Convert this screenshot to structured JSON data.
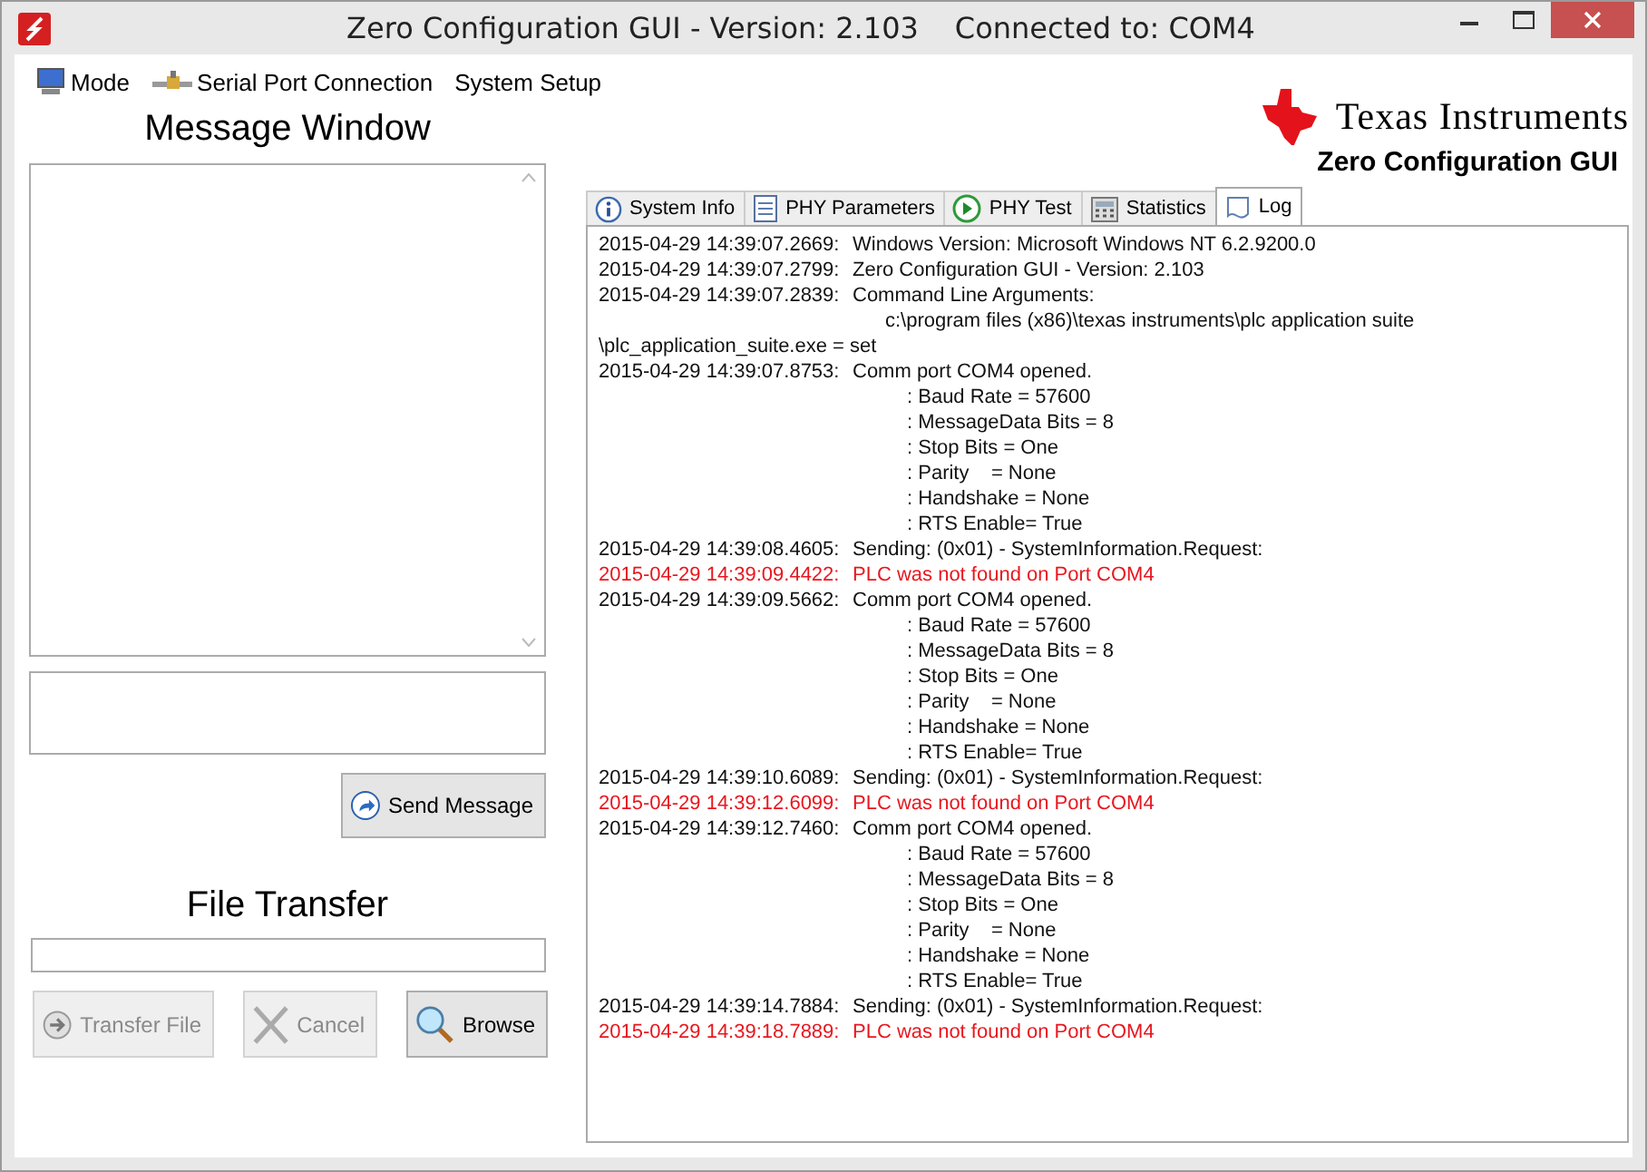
{
  "window": {
    "title": "Zero Configuration GUI - Version: 2.103",
    "connection": "Connected to: COM4"
  },
  "menu": [
    {
      "label": "Mode",
      "kind": "monitor"
    },
    {
      "label": "Serial Port Connection",
      "kind": "plug"
    },
    {
      "label": "System Setup",
      "kind": "none"
    }
  ],
  "brand": {
    "name": "Texas Instruments",
    "subtitle": "Zero Configuration GUI"
  },
  "message_window": {
    "title": "Message Window",
    "send_button": "Send Message"
  },
  "file_transfer": {
    "title": "File Transfer",
    "buttons": [
      {
        "label": "Transfer File",
        "kind": "arrow",
        "disabled": true
      },
      {
        "label": "Cancel",
        "kind": "cross",
        "disabled": true
      },
      {
        "label": "Browse",
        "kind": "magnifier",
        "disabled": false
      }
    ]
  },
  "tabs": [
    {
      "label": "System Info",
      "kind": "info",
      "selected": false
    },
    {
      "label": "PHY Parameters",
      "kind": "doc",
      "selected": false
    },
    {
      "label": "PHY Test",
      "kind": "play",
      "selected": false
    },
    {
      "label": "Statistics",
      "kind": "calc",
      "selected": false
    },
    {
      "label": "Log",
      "kind": "page",
      "selected": true
    }
  ],
  "log": [
    {
      "kind": "entry",
      "time": "2015-04-29 14:39:07.2669:",
      "text": "Windows Version: Microsoft Windows NT 6.2.9200.0",
      "error": false
    },
    {
      "kind": "entry",
      "time": "2015-04-29 14:39:07.2799:",
      "text": "Zero Configuration GUI - Version: 2.103",
      "error": false
    },
    {
      "kind": "entry",
      "time": "2015-04-29 14:39:07.2839:",
      "text": "Command Line Arguments:",
      "error": false
    },
    {
      "kind": "arg",
      "text": "c:\\program files (x86)\\texas instruments\\plc application suite"
    },
    {
      "kind": "wrap",
      "text": "\\plc_application_suite.exe = set"
    },
    {
      "kind": "entry",
      "time": "2015-04-29 14:39:07.8753:",
      "text": "Comm port COM4 opened.",
      "error": false
    },
    {
      "kind": "detail",
      "text": ": Baud Rate = 57600"
    },
    {
      "kind": "detail",
      "text": ": MessageData Bits = 8"
    },
    {
      "kind": "detail",
      "text": ": Stop Bits = One"
    },
    {
      "kind": "detail",
      "text": ": Parity    = None"
    },
    {
      "kind": "detail",
      "text": ": Handshake = None"
    },
    {
      "kind": "detail",
      "text": ": RTS Enable= True"
    },
    {
      "kind": "entry",
      "time": "2015-04-29 14:39:08.4605:",
      "text": "Sending: (0x01) - SystemInformation.Request:",
      "error": false
    },
    {
      "kind": "entry",
      "time": "2015-04-29 14:39:09.4422:",
      "text": "PLC was not found on Port COM4",
      "error": true
    },
    {
      "kind": "entry",
      "time": "2015-04-29 14:39:09.5662:",
      "text": "Comm port COM4 opened.",
      "error": false
    },
    {
      "kind": "detail",
      "text": ": Baud Rate = 57600"
    },
    {
      "kind": "detail",
      "text": ": MessageData Bits = 8"
    },
    {
      "kind": "detail",
      "text": ": Stop Bits = One"
    },
    {
      "kind": "detail",
      "text": ": Parity    = None"
    },
    {
      "kind": "detail",
      "text": ": Handshake = None"
    },
    {
      "kind": "detail",
      "text": ": RTS Enable= True"
    },
    {
      "kind": "entry",
      "time": "2015-04-29 14:39:10.6089:",
      "text": "Sending: (0x01) - SystemInformation.Request:",
      "error": false
    },
    {
      "kind": "entry",
      "time": "2015-04-29 14:39:12.6099:",
      "text": "PLC was not found on Port COM4",
      "error": true
    },
    {
      "kind": "entry",
      "time": "2015-04-29 14:39:12.7460:",
      "text": "Comm port COM4 opened.",
      "error": false
    },
    {
      "kind": "detail",
      "text": ": Baud Rate = 57600"
    },
    {
      "kind": "detail",
      "text": ": MessageData Bits = 8"
    },
    {
      "kind": "detail",
      "text": ": Stop Bits = One"
    },
    {
      "kind": "detail",
      "text": ": Parity    = None"
    },
    {
      "kind": "detail",
      "text": ": Handshake = None"
    },
    {
      "kind": "detail",
      "text": ": RTS Enable= True"
    },
    {
      "kind": "entry",
      "time": "2015-04-29 14:39:14.7884:",
      "text": "Sending: (0x01) - SystemInformation.Request:",
      "error": false
    },
    {
      "kind": "entry",
      "time": "2015-04-29 14:39:18.7889:",
      "text": "PLC was not found on Port COM4",
      "error": true
    }
  ]
}
